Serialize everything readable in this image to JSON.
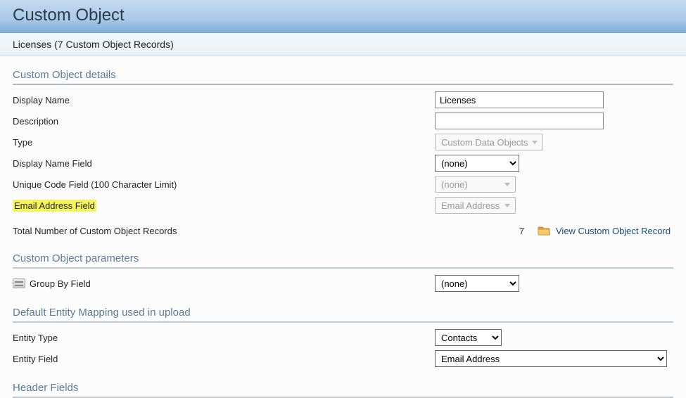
{
  "header": {
    "title": "Custom Object",
    "subtitle": "Licenses (7 Custom Object Records)"
  },
  "sections": {
    "details_title": "Custom Object details",
    "params_title": "Custom Object parameters",
    "mapping_title": "Default Entity Mapping used in upload",
    "header_fields_title": "Header Fields"
  },
  "details": {
    "display_name_label": "Display Name",
    "display_name_value": "Licenses",
    "description_label": "Description",
    "description_value": "",
    "type_label": "Type",
    "type_value": "Custom Data Objects",
    "display_name_field_label": "Display Name Field",
    "display_name_field_value": "(none)",
    "unique_code_label": "Unique Code Field (100 Character Limit)",
    "unique_code_value": "(none)",
    "email_field_label": "Email Address Field",
    "email_field_value": "Email Address",
    "total_records_label": "Total Number of Custom Object Records",
    "total_records_value": "7",
    "view_records_link": "View Custom Object Record"
  },
  "params": {
    "group_by_label": "Group By Field",
    "group_by_value": "(none)"
  },
  "mapping": {
    "entity_type_label": "Entity Type",
    "entity_type_value": "Contacts",
    "entity_field_label": "Entity Field",
    "entity_field_value": "Email Address"
  }
}
